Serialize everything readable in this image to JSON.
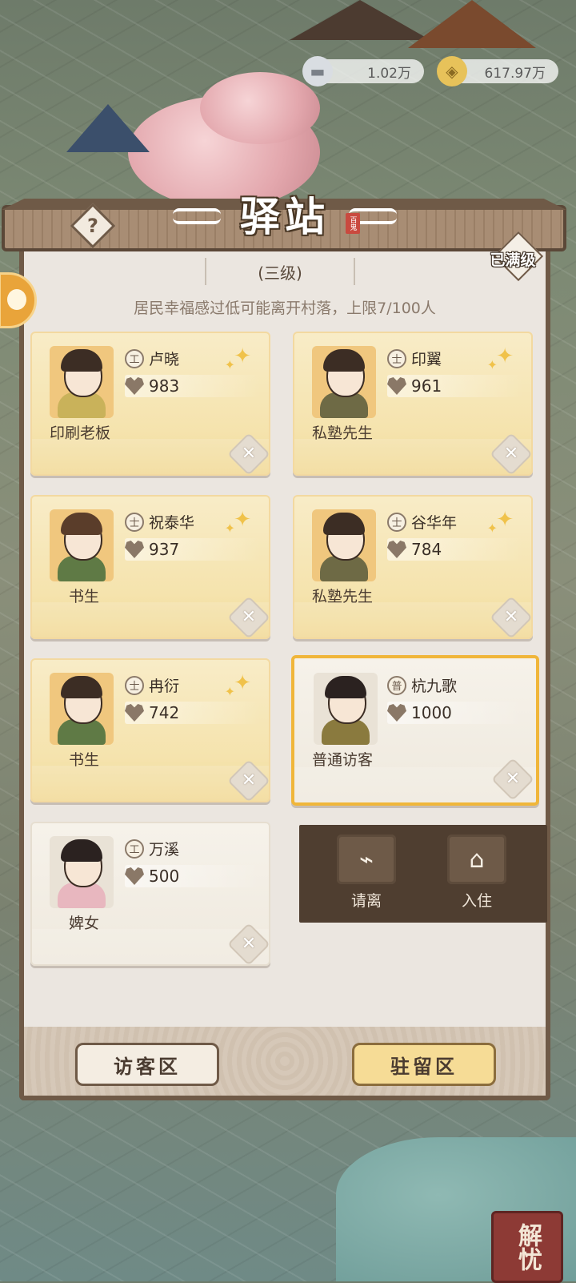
{
  "currency": {
    "silver": "1.02万",
    "coins": "617.97万"
  },
  "panel": {
    "title": "驿站",
    "seal_text": "百鬼",
    "level": "(三级)",
    "maxed_label": "已满级",
    "notice": "居民幸福感过低可能离开村落，上限7/100人"
  },
  "residents": [
    {
      "name": "卢晓",
      "class_badge": "工",
      "value": "983",
      "role": "印刷老板",
      "style": "gold"
    },
    {
      "name": "印翼",
      "class_badge": "士",
      "value": "961",
      "role": "私塾先生",
      "style": "gold"
    },
    {
      "name": "祝泰华",
      "class_badge": "士",
      "value": "937",
      "role": "书生",
      "style": "gold"
    },
    {
      "name": "谷华年",
      "class_badge": "士",
      "value": "784",
      "role": "私塾先生",
      "style": "gold"
    },
    {
      "name": "冉衍",
      "class_badge": "士",
      "value": "742",
      "role": "书生",
      "style": "gold"
    },
    {
      "name": "杭九歌",
      "class_badge": "普",
      "value": "1000",
      "role": "普通访客",
      "style": "plain",
      "selected": true
    },
    {
      "name": "万溪",
      "class_badge": "工",
      "value": "500",
      "role": "婢女",
      "style": "plain"
    }
  ],
  "actions": {
    "dismiss_label": "请离",
    "checkin_label": "入住"
  },
  "tabs": {
    "visitors_label": "访客区",
    "stay_label": "驻留区"
  },
  "help_icon": "?",
  "stamp_text": "解忧",
  "colors": {
    "frame": "#6f5a47",
    "gold_card": "#f5e3ad",
    "selected_border": "#f0b63a",
    "action_bg": "#4f3e30"
  }
}
